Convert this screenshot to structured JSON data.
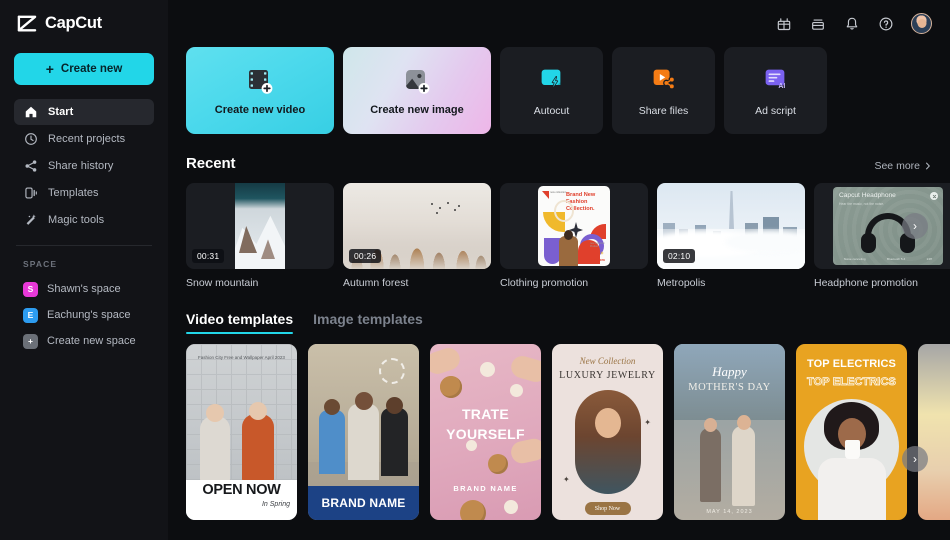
{
  "app": {
    "brand": "CapCut"
  },
  "sidebar": {
    "create_new_label": "Create new",
    "nav": [
      {
        "label": "Start",
        "icon": "home-icon",
        "active": true
      },
      {
        "label": "Recent projects",
        "icon": "clock-icon",
        "active": false
      },
      {
        "label": "Share history",
        "icon": "share-icon",
        "active": false
      },
      {
        "label": "Templates",
        "icon": "templates-icon",
        "active": false
      },
      {
        "label": "Magic tools",
        "icon": "magic-wand-icon",
        "active": false
      }
    ],
    "space_heading": "SPACE",
    "spaces": [
      {
        "label": "Shawn's space",
        "initial": "S",
        "color": "#e838d8"
      },
      {
        "label": "Eachung's space",
        "initial": "E",
        "color": "#2d9cf0"
      },
      {
        "label": "Create new space",
        "initial": "+",
        "color": "#6b7078"
      }
    ]
  },
  "topbar": {
    "icons": [
      "gift-icon",
      "inbox-icon",
      "bell-icon",
      "help-icon"
    ],
    "avatar": "user-avatar"
  },
  "actions": [
    {
      "label": "Create new video",
      "icon": "film-plus-icon",
      "style": "video"
    },
    {
      "label": "Create new image",
      "icon": "image-plus-icon",
      "style": "image"
    },
    {
      "label": "Autocut",
      "icon": "autocut-icon",
      "color": "#22d6e8"
    },
    {
      "label": "Share files",
      "icon": "share-files-icon",
      "color": "#f57c15"
    },
    {
      "label": "Ad script",
      "icon": "ad-script-ai-icon",
      "color": "#7b62f0"
    }
  ],
  "recent": {
    "title": "Recent",
    "see_more": "See more",
    "items": [
      {
        "name": "Snow mountain",
        "duration": "00:31",
        "art": "snow"
      },
      {
        "name": "Autumn forest",
        "duration": "00:26",
        "art": "forest"
      },
      {
        "name": "Clothing promotion",
        "duration": "",
        "art": "clothing"
      },
      {
        "name": "Metropolis",
        "duration": "02:10",
        "art": "metropolis"
      },
      {
        "name": "Headphone promotion",
        "duration": "",
        "art": "headphone"
      }
    ],
    "headphone_card": {
      "title": "Capcut Headphone",
      "subtitle": "Hear the music, not the noise.",
      "features": [
        "Noise canceling",
        "Bluetooth 5.3",
        "24H"
      ]
    }
  },
  "templates": {
    "tabs": [
      {
        "label": "Video templates",
        "active": true
      },
      {
        "label": "Image templates",
        "active": false
      }
    ],
    "items": [
      {
        "art": "t1",
        "top_note": "Fashion City\nFree and Wallpaper\nApril 2023",
        "headline": "OPEN NOW",
        "sub": "In Spring"
      },
      {
        "art": "t2",
        "headline": "BRAND NAME"
      },
      {
        "art": "t3",
        "line1": "TRATE",
        "line2": "YOURSELF",
        "brand": "BRAND NAME"
      },
      {
        "art": "t4",
        "script": "New Collection",
        "headline": "LUXURY JEWELRY",
        "button": "Shop Now"
      },
      {
        "art": "t5",
        "script": "Happy",
        "headline": "MOTHER'S DAY",
        "date": "MAY 14, 2023"
      },
      {
        "art": "t6",
        "line1": "TOP ELECTRICS",
        "line2": "TOP ELECTRICS"
      },
      {
        "art": "t7"
      }
    ]
  },
  "nav_arrows": {
    "recent": "›",
    "templates": "›"
  },
  "colors": {
    "accent": "#22d6e8",
    "bg": "#0c0d10",
    "sidebar": "#121317",
    "card": "#1b1d22"
  }
}
